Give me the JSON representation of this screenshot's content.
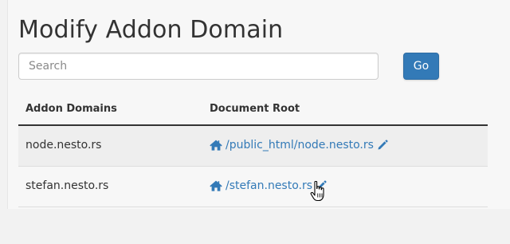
{
  "page": {
    "title": "Modify Addon Domain"
  },
  "search": {
    "placeholder": "Search",
    "value": "",
    "go_label": "Go"
  },
  "table": {
    "headers": [
      "Addon Domains",
      "Document Root"
    ],
    "rows": [
      {
        "domain": "node.nesto.rs",
        "document_root": "/public_html/node.nesto.rs"
      },
      {
        "domain": "stefan.nesto.rs",
        "document_root": "/stefan.nesto.rs"
      }
    ]
  },
  "icons": {
    "home": "home-icon",
    "edit": "pencil-icon",
    "cursor": "pointer-hand-icon"
  },
  "colors": {
    "primary": "#337ab7",
    "text": "#333333",
    "row_alt": "#eeeeee"
  }
}
